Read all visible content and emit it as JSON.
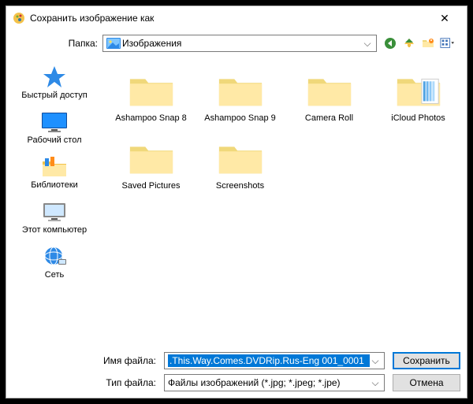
{
  "window": {
    "title": "Сохранить изображение как",
    "close": "✕"
  },
  "folderbar": {
    "label": "Папка:",
    "current": "Изображения"
  },
  "places": [
    {
      "label": "Быстрый доступ"
    },
    {
      "label": "Рабочий стол"
    },
    {
      "label": "Библиотеки"
    },
    {
      "label": "Этот компьютер"
    },
    {
      "label": "Сеть"
    }
  ],
  "items": [
    {
      "label": "Ashampoo Snap 8",
      "type": "folder"
    },
    {
      "label": "Ashampoo Snap 9",
      "type": "folder"
    },
    {
      "label": "Camera Roll",
      "type": "folder"
    },
    {
      "label": "iCloud Photos",
      "type": "folder-icloud"
    },
    {
      "label": "Saved Pictures",
      "type": "folder"
    },
    {
      "label": "Screenshots",
      "type": "folder"
    }
  ],
  "bottom": {
    "filename_label": "Имя файла:",
    "filename_value": ".This.Way.Comes.DVDRip.Rus-Eng 001_0001",
    "filetype_label": "Тип файла:",
    "filetype_value": "Файлы изображений (*.jpg; *.jpeg; *.jpe)",
    "save": "Сохранить",
    "cancel": "Отмена"
  }
}
